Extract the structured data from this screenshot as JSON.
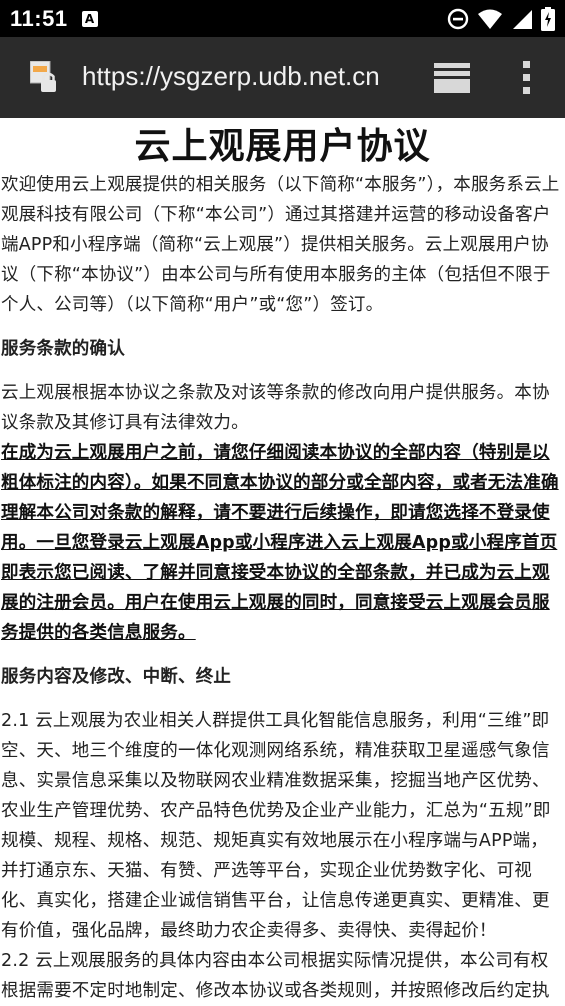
{
  "status_bar": {
    "time": "11:51",
    "notification_badge": "A",
    "icons": [
      "do-not-disturb-icon",
      "wifi-icon",
      "signal-icon",
      "battery-icon"
    ]
  },
  "browser": {
    "url": "https://ysgzerp.udb.net.cn",
    "icons": [
      "site-lock-icon",
      "tabs-icon",
      "menu-icon"
    ]
  },
  "doc": {
    "title": "云上观展用户协议",
    "intro": "欢迎使用云上观展提供的相关服务（以下简称“本服务”），本服务系云上观展科技有限公司（下称“本公司”）通过其搭建并运营的移动设备客户端APP和小程序端（简称“云上观展”）提供相关服务。云上观展用户协议（下称“本协议”）由本公司与所有使用本服务的主体（包括但不限于个人、公司等）（以下简称“用户”或“您”）签订。",
    "section1_heading": "服务条款的确认",
    "section1_para": "云上观展根据本协议之条款及对该等条款的修改向用户提供服务。本协议条款及其修订具有法律效力。",
    "section1_notice": "在成为云上观展用户之前，请您仔细阅读本协议的全部内容（特别是以粗体标注的内容）。如果不同意本协议的部分或全部内容，或者无法准确理解本公司对条款的解释，请不要进行后续操作，即请您选择不登录使用。一旦您登录云上观展App或小程序进入云上观展App或小程序首页即表示您已阅读、了解并同意接受本协议的全部条款，并已成为云上观展的注册会员。用户在使用云上观展的同时，同意接受云上观展会员服务提供的各类信息服务。",
    "section2_heading": "服务内容及修改、中断、终止",
    "section2_p1": "2.1 云上观展为农业相关人群提供工具化智能信息服务，利用“三维”即空、天、地三个维度的一体化观测网络系统，精准获取卫星遥感气象信息、实景信息采集以及物联网农业精准数据采集，挖掘当地产区优势、农业生产管理优势、农产品特色优势及企业产业能力，汇总为“五规”即规模、规程、规格、规范、规矩真实有效地展示在小程序端与APP端，并打通京东、天猫、有赞、严选等平台，实现企业优势数字化、可视化、真实化，搭建企业诚信销售平台，让信息传递更真实、更精准、更有价值，强化品牌，最终助力农企卖得多、卖得快、卖得起价！",
    "section2_p2": "2.2 云上观展服务的具体内容由本公司根据实际情况提供，本公司有权根据需要不定时地制定、修改本协议或各类规则，并按照修改后约定执"
  }
}
